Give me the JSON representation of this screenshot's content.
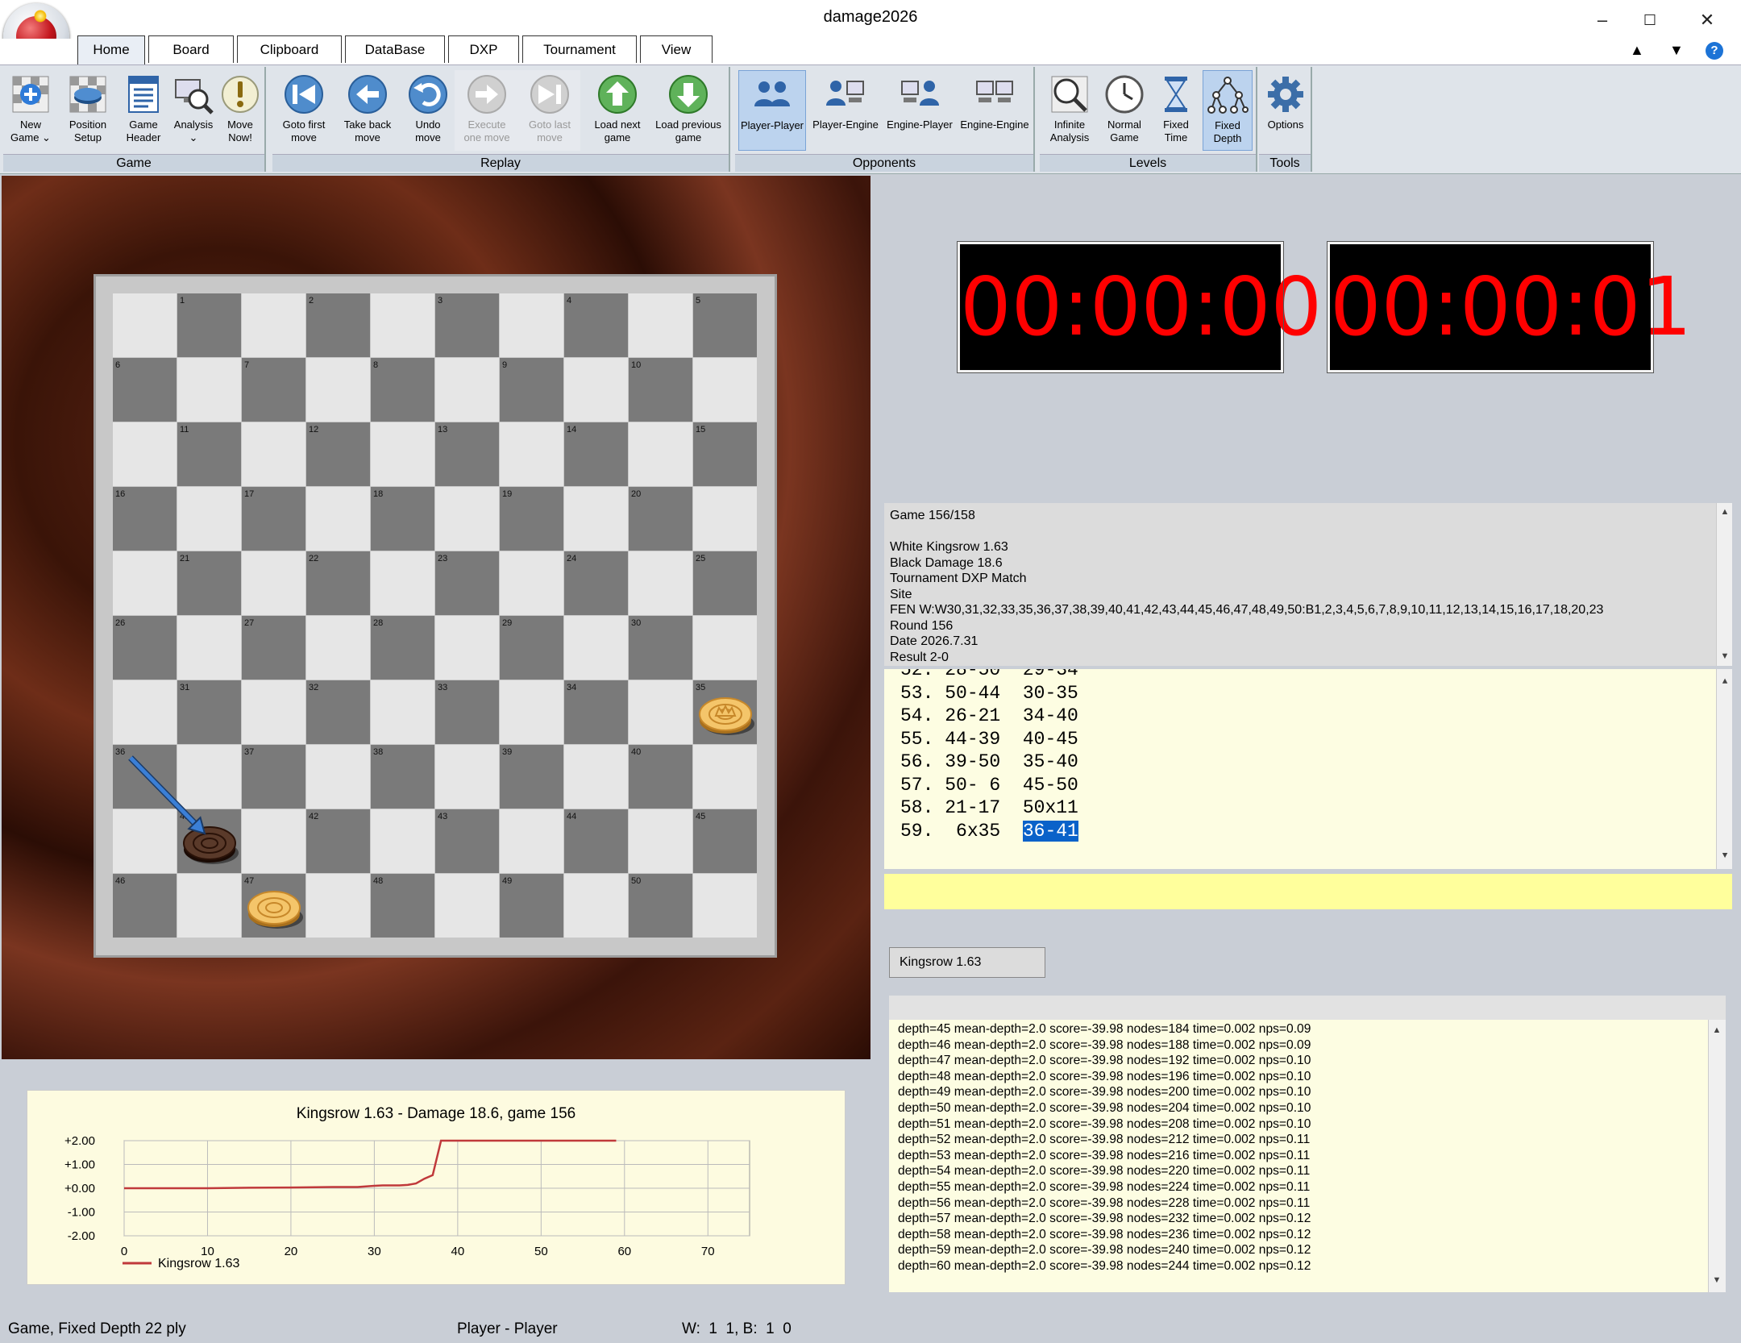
{
  "window": {
    "title": "damage2026",
    "minimize": "–",
    "maximize": "☐",
    "close": "✕"
  },
  "tabs": [
    "Home",
    "Board",
    "Clipboard",
    "DataBase",
    "DXP",
    "Tournament",
    "View"
  ],
  "quick_access": {
    "up": "▲",
    "down": "▼",
    "help": "?"
  },
  "ribbon": {
    "game": {
      "label": "Game",
      "buttons": [
        {
          "label": "New\nGame ⌄",
          "icon": "new-game-icon"
        },
        {
          "label": "Position\nSetup",
          "icon": "position-setup-icon"
        },
        {
          "label": "Game\nHeader",
          "icon": "game-header-icon"
        },
        {
          "label": "Analysis\n⌄",
          "icon": "analysis-icon"
        },
        {
          "label": "Move\nNow!",
          "icon": "move-now-icon"
        }
      ]
    },
    "replay": {
      "label": "Replay",
      "buttons": [
        {
          "label": "Goto first\nmove",
          "icon": "goto-first-icon"
        },
        {
          "label": "Take back\nmove",
          "icon": "take-back-icon"
        },
        {
          "label": "Undo\nmove",
          "icon": "undo-icon"
        },
        {
          "label": "Execute\none move",
          "icon": "execute-icon",
          "disabled": true
        },
        {
          "label": "Goto last\nmove",
          "icon": "goto-last-icon",
          "disabled": true
        },
        {
          "label": "Load next\ngame",
          "icon": "load-next-icon"
        },
        {
          "label": "Load previous\ngame",
          "icon": "load-previous-icon"
        }
      ]
    },
    "opponents": {
      "label": "Opponents",
      "buttons": [
        {
          "label": "Player-Player",
          "icon": "player-player-icon",
          "selected": true
        },
        {
          "label": "Player-Engine",
          "icon": "player-engine-icon"
        },
        {
          "label": "Engine-Player",
          "icon": "engine-player-icon"
        },
        {
          "label": "Engine-Engine",
          "icon": "engine-engine-icon"
        }
      ]
    },
    "levels": {
      "label": "Levels",
      "buttons": [
        {
          "label": "Infinite\nAnalysis",
          "icon": "infinite-analysis-icon"
        },
        {
          "label": "Normal\nGame",
          "icon": "clock-icon"
        },
        {
          "label": "Fixed\nTime",
          "icon": "hourglass-icon"
        },
        {
          "label": "Fixed\nDepth",
          "icon": "tree-icon",
          "selected": true
        }
      ]
    },
    "tools": {
      "label": "Tools",
      "buttons": [
        {
          "label": "Options",
          "icon": "gear-icon"
        }
      ]
    }
  },
  "clocks": {
    "white": "00:00:00",
    "black": "00:00:01"
  },
  "game_info": [
    "Game 156/158",
    "",
    "White Kingsrow 1.63",
    "Black Damage 18.6",
    "Tournament DXP Match",
    "Site",
    "FEN W:W30,31,32,33,35,36,37,38,39,40,41,42,43,44,45,46,47,48,49,50:B1,2,3,4,5,6,7,8,9,10,11,12,13,14,15,16,17,18,20,23",
    "Round 156",
    "Date 2026.7.31",
    "Result 2-0"
  ],
  "moves": [
    {
      "n": "52.",
      "w": "28-50",
      "b": "29-34"
    },
    {
      "n": "53.",
      "w": "50-44",
      "b": "30-35"
    },
    {
      "n": "54.",
      "w": "26-21",
      "b": "34-40"
    },
    {
      "n": "55.",
      "w": "44-39",
      "b": "40-45"
    },
    {
      "n": "56.",
      "w": "39-50",
      "b": "35-40"
    },
    {
      "n": "57.",
      "w": "50- 6",
      "b": "45-50"
    },
    {
      "n": "58.",
      "w": "21-17",
      "b": "50x11"
    },
    {
      "n": "59.",
      "w": " 6x35",
      "b": "36-41",
      "highlight": true
    }
  ],
  "engine_name": "Kingsrow 1.63",
  "analysis_lines": [
    "depth=45 mean-depth=2.0 score=-39.98 nodes=184 time=0.002 nps=0.09",
    "depth=46 mean-depth=2.0 score=-39.98 nodes=188 time=0.002 nps=0.09",
    "depth=47 mean-depth=2.0 score=-39.98 nodes=192 time=0.002 nps=0.10",
    "depth=48 mean-depth=2.0 score=-39.98 nodes=196 time=0.002 nps=0.10",
    "depth=49 mean-depth=2.0 score=-39.98 nodes=200 time=0.002 nps=0.10",
    "depth=50 mean-depth=2.0 score=-39.98 nodes=204 time=0.002 nps=0.10",
    "depth=51 mean-depth=2.0 score=-39.98 nodes=208 time=0.002 nps=0.10",
    "depth=52 mean-depth=2.0 score=-39.98 nodes=212 time=0.002 nps=0.11",
    "depth=53 mean-depth=2.0 score=-39.98 nodes=216 time=0.002 nps=0.11",
    "depth=54 mean-depth=2.0 score=-39.98 nodes=220 time=0.002 nps=0.11",
    "depth=55 mean-depth=2.0 score=-39.98 nodes=224 time=0.002 nps=0.11",
    "depth=56 mean-depth=2.0 score=-39.98 nodes=228 time=0.002 nps=0.11",
    "depth=57 mean-depth=2.0 score=-39.98 nodes=232 time=0.002 nps=0.12",
    "depth=58 mean-depth=2.0 score=-39.98 nodes=236 time=0.002 nps=0.12",
    "depth=59 mean-depth=2.0 score=-39.98 nodes=240 time=0.002 nps=0.12",
    "depth=60 mean-depth=2.0 score=-39.98 nodes=244 time=0.002 nps=0.12"
  ],
  "board": {
    "square_numbers": [
      1,
      2,
      3,
      4,
      5,
      6,
      7,
      8,
      9,
      10,
      11,
      12,
      13,
      14,
      15,
      16,
      17,
      18,
      19,
      20,
      21,
      22,
      23,
      24,
      25,
      26,
      27,
      28,
      29,
      30,
      31,
      32,
      33,
      34,
      35,
      36,
      37,
      38,
      39,
      40,
      41,
      42,
      43,
      44,
      45,
      46,
      47,
      48,
      49,
      50
    ],
    "pieces": [
      {
        "square": 35,
        "color": "white",
        "king": true
      },
      {
        "square": 41,
        "color": "black",
        "king": false
      },
      {
        "square": 47,
        "color": "white",
        "king": false
      }
    ],
    "last_move": {
      "from": 36,
      "to": 41
    },
    "colors": {
      "light": "#e6e6e6",
      "dark": "#7a7a7a",
      "arrow": "#3b7fd6"
    }
  },
  "chart_data": {
    "type": "line",
    "title": "Kingsrow 1.63 - Damage 18.6, game 156",
    "xlabel": "",
    "ylabel": "",
    "xlim": [
      0,
      75
    ],
    "ylim": [
      -2,
      2
    ],
    "x_ticks": [
      0,
      10,
      20,
      30,
      40,
      50,
      60,
      70
    ],
    "y_ticks": [
      "+2.00",
      "+1.00",
      "+0.00",
      "-1.00",
      "-2.00"
    ],
    "series": [
      {
        "name": "Kingsrow 1.63",
        "color": "#c0393b",
        "x": [
          0,
          5,
          10,
          15,
          20,
          25,
          28,
          30,
          31,
          33,
          34,
          35,
          36,
          37,
          38,
          40,
          45,
          50,
          55,
          59
        ],
        "y": [
          0.0,
          0.0,
          0.0,
          0.02,
          0.03,
          0.05,
          0.05,
          0.1,
          0.12,
          0.12,
          0.14,
          0.2,
          0.4,
          0.55,
          2.0,
          2.0,
          2.0,
          2.0,
          2.0,
          2.0
        ]
      }
    ],
    "legend": "bottom-left",
    "grid": true
  },
  "status": {
    "mode": "Game, Fixed Depth 22 ply",
    "opponents": "Player - Player",
    "score": "W:  1  1, B:  1  0"
  }
}
